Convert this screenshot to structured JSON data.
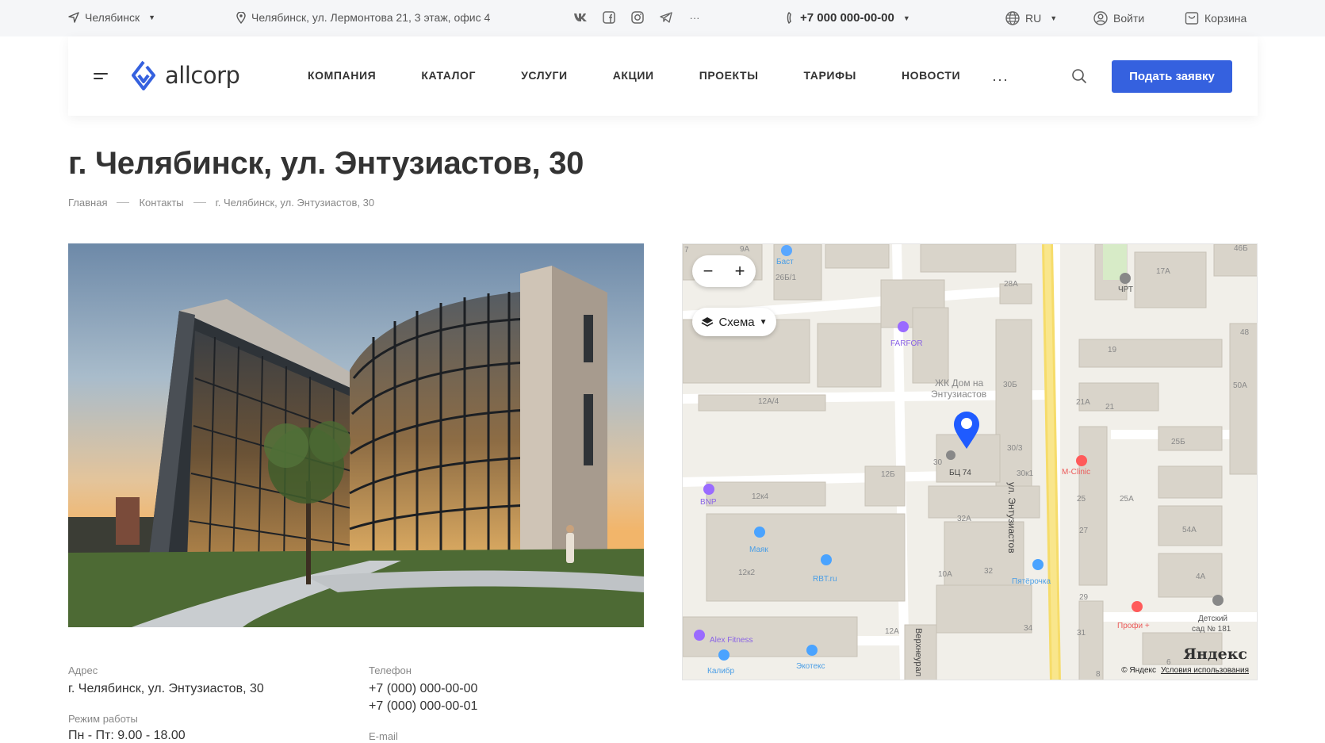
{
  "topbar": {
    "city": "Челябинск",
    "address": "Челябинск, ул. Лермонтова 21, 3 этаж, офис 4",
    "social": [
      {
        "icon": "vk-icon"
      },
      {
        "icon": "facebook-icon"
      },
      {
        "icon": "instagram-icon"
      },
      {
        "icon": "telegram-icon"
      },
      {
        "icon": "more-icon"
      }
    ],
    "more_label": "···",
    "phone": "+7 000 000-00-00",
    "lang": "RU",
    "login": "Войти",
    "cart": "Корзина"
  },
  "header": {
    "logo": "allcorp",
    "nav": [
      "КОМПАНИЯ",
      "КАТАЛОГ",
      "УСЛУГИ",
      "АКЦИИ",
      "ПРОЕКТЫ",
      "ТАРИФЫ",
      "НОВОСТИ"
    ],
    "more": "···",
    "cta": "Подать заявку"
  },
  "page": {
    "title": "г. Челябинск, ул. Энтузиастов, 30",
    "breadcrumbs": [
      "Главная",
      "Контакты",
      "г. Челябинск, ул. Энтузиастов, 30"
    ]
  },
  "map": {
    "zoom_out": "−",
    "zoom_in": "+",
    "layer": "Схема",
    "labels": {
      "bast": "Баст",
      "b26b1": "26Б/1",
      "b9a": "9А",
      "b28a": "28А",
      "b17a": "17А",
      "chrt": "ЧРТ",
      "farfor": "FARFOR",
      "b48": "48",
      "b19": "19",
      "zhk1": "ЖК Дом на",
      "zhk2": "Энтузиастов",
      "b30b": "30Б",
      "b21a": "21А",
      "b21": "21",
      "b50a": "50А",
      "b12a4": "12А/4",
      "b25b": "25Б",
      "b30_3": "30/3",
      "b30": "30",
      "bc74": "БЦ 74",
      "b12b": "12Б",
      "b30k1": "30к1",
      "mclinic": "M-Clinic",
      "street": "ул. Энтузиастов",
      "bnp": "BNP",
      "b12k4": "12к4",
      "b32a": "32А",
      "b25": "25",
      "b25a": "25А",
      "b27": "27",
      "b54a": "54А",
      "mayak": "Маяк",
      "b12k2": "12к2",
      "rbt": "RBT.ru",
      "b10a": "10А",
      "b32": "32",
      "pyat": "Пятёрочка",
      "b4a": "4А",
      "b29": "29",
      "profi": "Профи +",
      "det1": "Детский",
      "det2": "сад № 181",
      "b12a": "12А",
      "vverh": "Верхнеурал",
      "b34": "34",
      "b31": "31",
      "alex": "Alex Fitness",
      "ekotex": "Экотекс",
      "kalibr": "Калибр",
      "b8": "8",
      "b6": "6",
      "b46b": "46Б",
      "b7": "7"
    },
    "brand": "Яндекс",
    "copyright": "© Яндекс",
    "terms": "Условия использования"
  },
  "info": {
    "address_label": "Адрес",
    "address": "г. Челябинск, ул. Энтузиастов, 30",
    "hours_label": "Режим работы",
    "hours": "Пн - Пт: 9.00 - 18.00",
    "phone_label": "Телефон",
    "phones": [
      "+7 (000) 000-00-00",
      "+7 (000) 000-00-01"
    ],
    "email_label": "E-mail"
  }
}
